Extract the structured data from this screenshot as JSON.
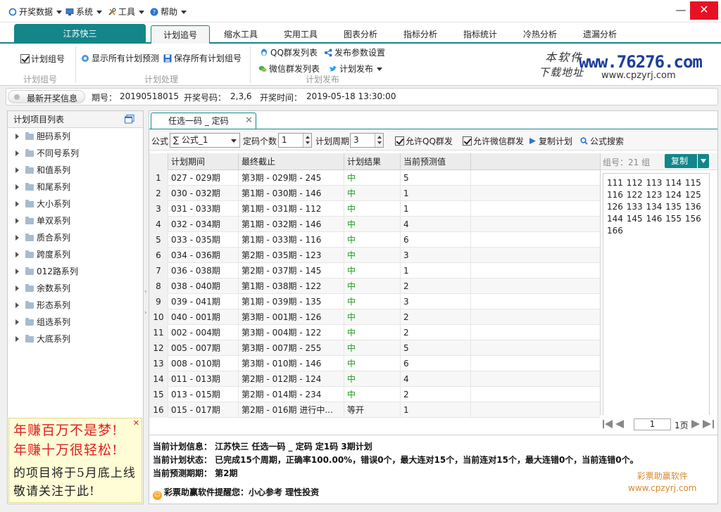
{
  "menubar": {
    "items": [
      {
        "label": "开奖数据",
        "icon": "circle-icon"
      },
      {
        "label": "系统",
        "icon": "monitor-icon"
      },
      {
        "label": "工具",
        "icon": "tools-icon"
      },
      {
        "label": "帮助",
        "icon": "help-icon"
      }
    ]
  },
  "window_controls": {
    "minimize": "—",
    "restore": "❐",
    "close": "✕"
  },
  "app_tab": "江苏快三",
  "tabs": [
    "计划追号",
    "缩水工具",
    "实用工具",
    "图表分析",
    "指标分析",
    "指标统计",
    "冷热分析",
    "遗漏分析"
  ],
  "ribbon": {
    "plan_group_checkbox": "计划组号",
    "group1_label": "计划组号",
    "show_all_plan": "显示所有计划预测",
    "save_all_plan": "保存所有计划组号",
    "group2_label": "计划处理",
    "qq_group_list": "QQ群发列表",
    "publish_settings": "发布参数设置",
    "wechat_group_list": "微信群发列表",
    "plan_publish": "计划发布",
    "group3_label": "计划发布"
  },
  "logo": {
    "handwriting_top": "本软件",
    "handwriting_bottom": "下载地址",
    "url_main": "www.76276.com",
    "url_sub": "www.cpzyrj.com"
  },
  "infobar": {
    "label": "最新开奖信息",
    "period_label": "期号：",
    "period": "20190518015",
    "number_label": "开奖号码：",
    "number": "2,3,6",
    "time_label": "开奖时间：",
    "time": "2019-05-18 13:30:00"
  },
  "left_panel": {
    "title": "计划项目列表",
    "items": [
      "胆码系列",
      "不同号系列",
      "和值系列",
      "和尾系列",
      "大小系列",
      "单双系列",
      "质合系列",
      "跨度系列",
      "012路系列",
      "余数系列",
      "形态系列",
      "组选系列",
      "大底系列"
    ],
    "ad": [
      "年赚百万不是梦!",
      "年赚十万很轻松!",
      "的项目将于5月底上线",
      "敬请关注于此!"
    ]
  },
  "doc_tab": {
    "label": "任选一码 _ 定码",
    "close": "✕"
  },
  "toolbar": {
    "formula_label": "公式",
    "formula_value": "∑ 公式_1",
    "count_label": "定码个数",
    "count_value": "1",
    "cycle_label": "计划周期",
    "cycle_value": "3",
    "allow_qq": "允许QQ群发",
    "allow_wechat": "允许微信群发",
    "copy_plan": "复制计划",
    "formula_search": "公式搜索"
  },
  "grid": {
    "columns": [
      "",
      "计划期间",
      "最终截止",
      "计划结果",
      "当前预测值"
    ],
    "rows": [
      [
        "1",
        "027 - 029期",
        "第3期 - 029期 - 245",
        "中",
        "5"
      ],
      [
        "2",
        "030 - 032期",
        "第1期 - 030期 - 146",
        "中",
        "1"
      ],
      [
        "3",
        "031 - 033期",
        "第1期 - 031期 - 112",
        "中",
        "1"
      ],
      [
        "4",
        "032 - 034期",
        "第1期 - 032期 - 146",
        "中",
        "4"
      ],
      [
        "5",
        "033 - 035期",
        "第1期 - 033期 - 116",
        "中",
        "6"
      ],
      [
        "6",
        "034 - 036期",
        "第2期 - 035期 - 123",
        "中",
        "3"
      ],
      [
        "7",
        "036 - 038期",
        "第2期 - 037期 - 145",
        "中",
        "1"
      ],
      [
        "8",
        "038 - 040期",
        "第1期 - 038期 - 122",
        "中",
        "2"
      ],
      [
        "9",
        "039 - 041期",
        "第1期 - 039期 - 135",
        "中",
        "3"
      ],
      [
        "10",
        "040 - 001期",
        "第3期 - 001期 - 126",
        "中",
        "2"
      ],
      [
        "11",
        "002 - 004期",
        "第3期 - 004期 - 122",
        "中",
        "2"
      ],
      [
        "12",
        "005 - 007期",
        "第3期 - 007期 - 255",
        "中",
        "5"
      ],
      [
        "13",
        "008 - 010期",
        "第3期 - 010期 - 146",
        "中",
        "6"
      ],
      [
        "14",
        "011 - 013期",
        "第2期 - 012期 - 124",
        "中",
        "4"
      ],
      [
        "15",
        "013 - 015期",
        "第2期 - 014期 - 234",
        "中",
        "2"
      ],
      [
        "16",
        "015 - 017期",
        "第2期 - 016期 进行中...",
        "等开",
        "1"
      ]
    ]
  },
  "right_panel": {
    "group_count": "组号：21 组",
    "copy_button": "复制",
    "numbers": "111 112 113 114 115 116 122 123 124 125 126 133 134 135 136 144 145 146 155 156 166",
    "page_value": "1",
    "page_total": "1页"
  },
  "bottom": {
    "line1": "当前计划信息：  江苏快三    任选一码 _ 定码    定1码    3期计划",
    "line2": "当前计划状态：  已完成15个周期，正确率100.00%，错误0个，最大连对15个，当前连对15个，最大连错0个，当前连错0个。",
    "line3": "当前预测期期：  第2期",
    "line4": "彩票助赢软件提醒您：小心参考    理性投资",
    "watermark1": "彩票助赢软件",
    "watermark2": "www.cpzyrj.com"
  }
}
